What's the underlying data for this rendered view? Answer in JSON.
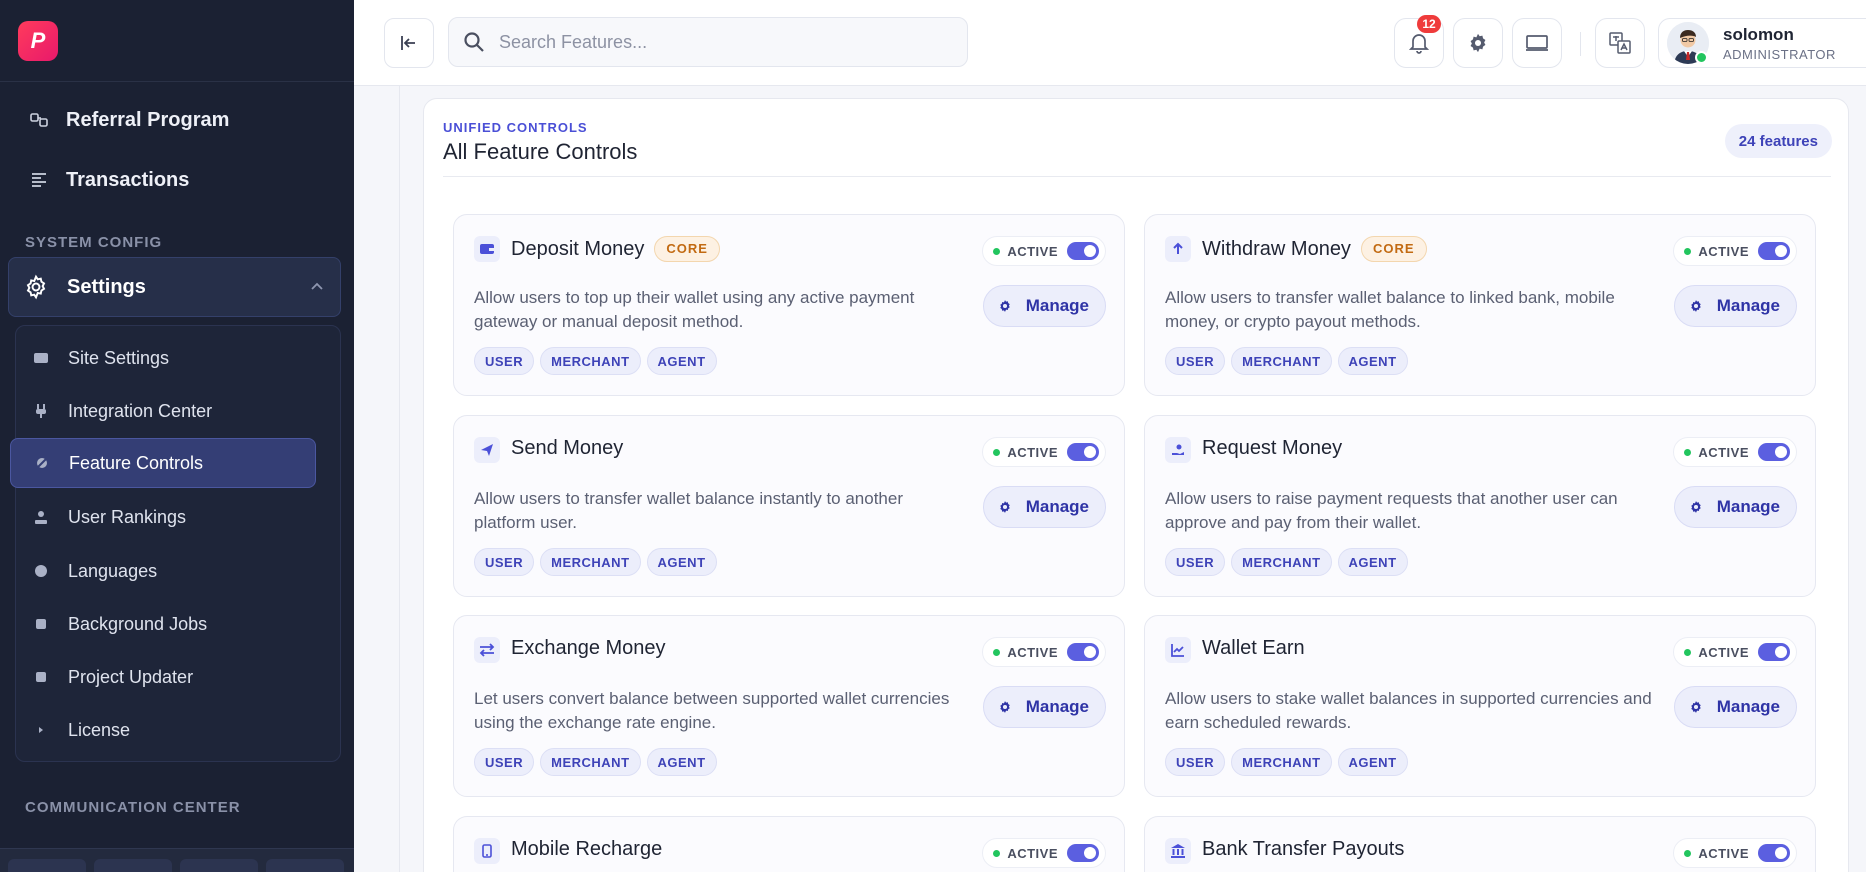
{
  "sidebar": {
    "logo_text": "P",
    "top_items": [
      {
        "label": "Referral Program",
        "icon": "referral-icon"
      },
      {
        "label": "Transactions",
        "icon": "list-icon"
      }
    ],
    "section_system": "SYSTEM CONFIG",
    "settings_label": "Settings",
    "sub_items": [
      {
        "label": "Site Settings",
        "icon": "card-icon"
      },
      {
        "label": "Integration Center",
        "icon": "plug-icon"
      },
      {
        "label": "Feature Controls",
        "icon": "sliders-icon",
        "active": true
      },
      {
        "label": "User Rankings",
        "icon": "ranking-icon"
      },
      {
        "label": "Languages",
        "icon": "globe-icon"
      },
      {
        "label": "Background Jobs",
        "icon": "square-icon"
      },
      {
        "label": "Project Updater",
        "icon": "square-icon"
      },
      {
        "label": "License",
        "icon": "dot-icon"
      }
    ],
    "section_comm": "COMMUNICATION CENTER"
  },
  "header": {
    "search_placeholder": "Search Features...",
    "notification_count": "12",
    "user_name": "solomon",
    "user_role": "ADMINISTRATOR"
  },
  "panel": {
    "eyebrow": "UNIFIED CONTROLS",
    "title": "All Feature Controls",
    "count": "24 features"
  },
  "status_label": "ACTIVE",
  "manage_label": "Manage",
  "core_label": "CORE",
  "tag_labels": [
    "USER",
    "MERCHANT",
    "AGENT"
  ],
  "features": [
    {
      "title": "Deposit Money",
      "core": true,
      "icon": "wallet-icon",
      "desc": "Allow users to top up their wallet using any active payment gateway or manual deposit method."
    },
    {
      "title": "Withdraw Money",
      "core": true,
      "icon": "arrow-up-icon",
      "desc": "Allow users to transfer wallet balance to linked bank, mobile money, or crypto payout methods."
    },
    {
      "title": "Send Money",
      "core": false,
      "icon": "send-icon",
      "desc": "Allow users to transfer wallet balance instantly to another platform user."
    },
    {
      "title": "Request Money",
      "core": false,
      "icon": "hand-coin-icon",
      "desc": "Allow users to raise payment requests that another user can approve and pay from their wallet."
    },
    {
      "title": "Exchange Money",
      "core": false,
      "icon": "exchange-icon",
      "desc": "Let users convert balance between supported wallet currencies using the exchange rate engine."
    },
    {
      "title": "Wallet Earn",
      "core": false,
      "icon": "chart-up-icon",
      "desc": "Allow users to stake wallet balances in supported currencies and earn scheduled rewards."
    },
    {
      "title": "Mobile Recharge",
      "core": false,
      "icon": "phone-icon",
      "desc": ""
    },
    {
      "title": "Bank Transfer Payouts",
      "core": false,
      "icon": "bank-icon",
      "desc": ""
    }
  ]
}
